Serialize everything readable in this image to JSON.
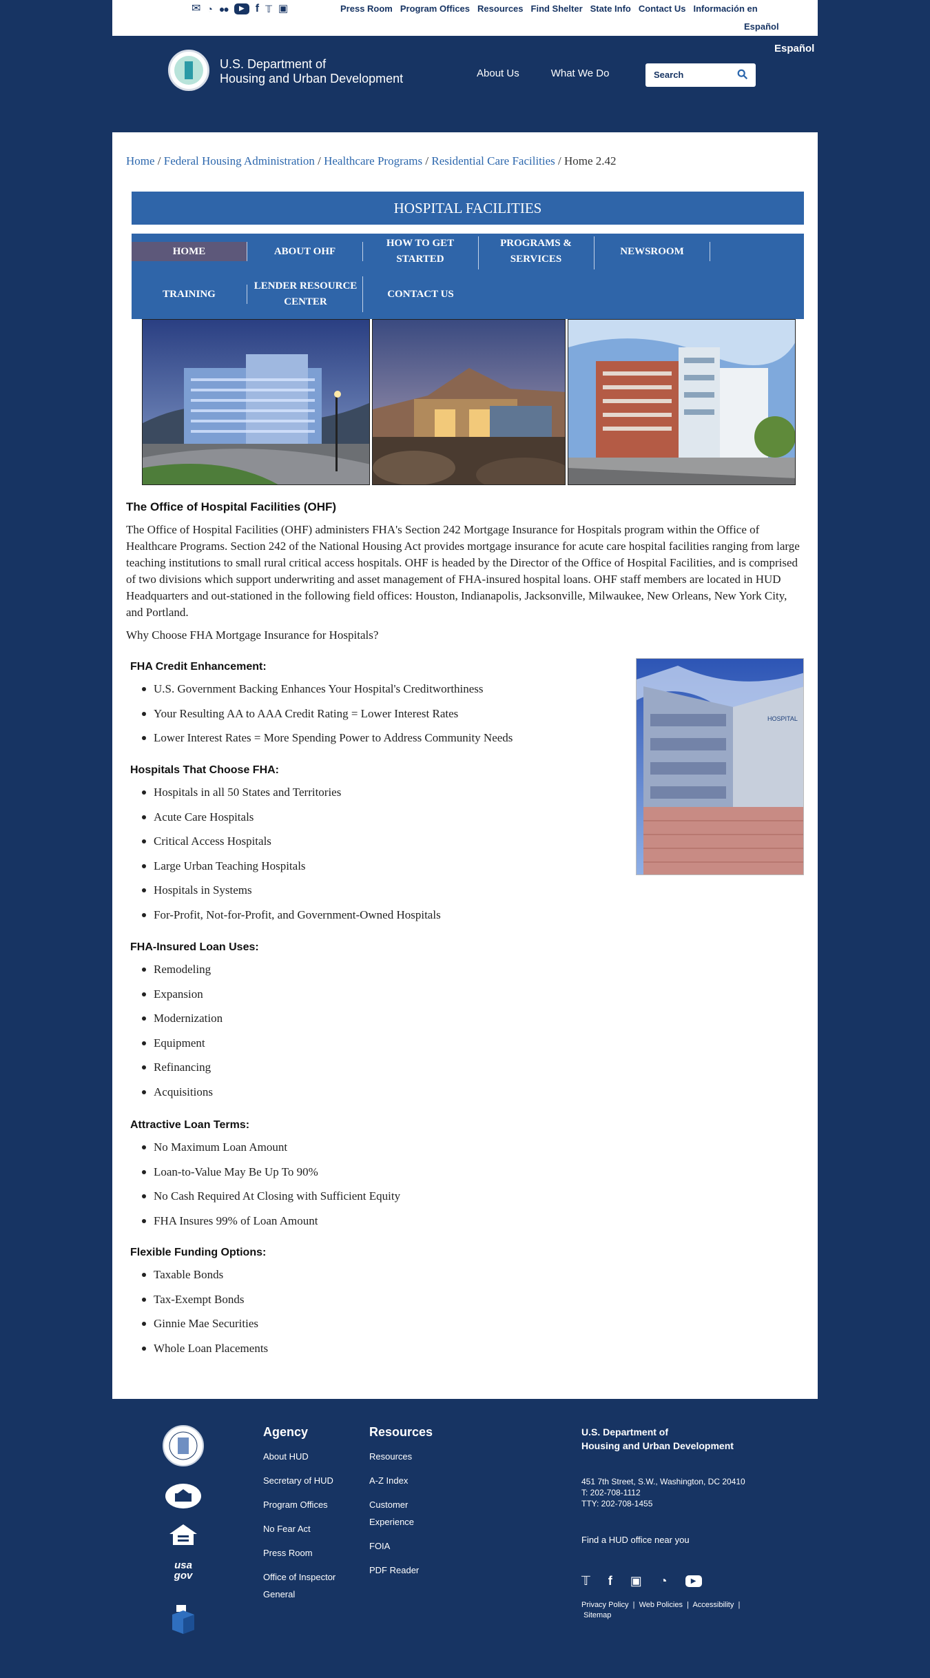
{
  "util": {
    "icons": [
      "mail-icon",
      "rss-icon",
      "flickr-icon",
      "youtube-icon",
      "facebook-icon",
      "twitter-icon",
      "instagram-icon"
    ],
    "links": [
      "Press Room",
      "Program Offices",
      "Resources",
      "Find Shelter",
      "State Info",
      "Contact Us",
      "Información en"
    ],
    "links_wrap": "Español"
  },
  "header": {
    "espanol": "Español",
    "agency_line1": "U.S. Department of",
    "agency_line2": "Housing and Urban Development",
    "nav": [
      "About Us",
      "What We Do"
    ],
    "search_placeholder": "Search"
  },
  "breadcrumb": {
    "items": [
      "Home",
      "Federal Housing Administration",
      "Healthcare Programs",
      "Residential Care Facilities"
    ],
    "current": "Home 2.42"
  },
  "hf": {
    "title": "HOSPITAL FACILITIES",
    "nav": [
      "HOME",
      "ABOUT OHF",
      "HOW TO GET STARTED",
      "PROGRAMS & SERVICES",
      "NEWSROOM",
      "TRAINING",
      "LENDER RESOURCE CENTER",
      "CONTACT US"
    ]
  },
  "ohf": {
    "heading": "The Office of Hospital Facilities (OHF)",
    "intro": "The Office of Hospital Facilities (OHF) administers FHA's Section 242 Mortgage Insurance for Hospitals program within the Office of Healthcare Programs. Section 242 of the National Housing Act provides mortgage insurance for acute care hospital facilities ranging from large teaching institutions to small rural critical access hospitals. OHF is headed by the Director of the Office of Hospital Facilities, and is comprised of two divisions which support underwriting and asset management of FHA-insured hospital loans. OHF staff members are located in HUD Headquarters and out-stationed in the following field offices: Houston, Indianapolis, Jacksonville, Milwaukee, New Orleans, New York City, and Portland.",
    "why": "Why Choose FHA Mortgage Insurance for Hospitals?"
  },
  "sections": [
    {
      "heading": "FHA Credit Enhancement:",
      "items": [
        "U.S. Government Backing Enhances Your Hospital's Creditworthiness",
        "Your Resulting AA to AAA Credit Rating = Lower Interest Rates",
        "Lower Interest Rates = More Spending Power to Address Community Needs"
      ]
    },
    {
      "heading": "Hospitals That Choose FHA:",
      "items": [
        "Hospitals in all 50 States and Territories",
        "Acute Care Hospitals",
        "Critical Access Hospitals",
        "Large Urban Teaching Hospitals",
        "Hospitals in Systems",
        "For-Profit, Not-for-Profit, and Government-Owned Hospitals"
      ]
    },
    {
      "heading": "FHA-Insured Loan Uses:",
      "items": [
        "Remodeling",
        "Expansion",
        "Modernization",
        "Equipment",
        "Refinancing",
        "Acquisitions"
      ]
    },
    {
      "heading": "Attractive Loan Terms:",
      "items": [
        "No Maximum Loan Amount",
        "Loan-to-Value May Be Up To 90%",
        "No Cash Required At Closing with Sufficient Equity",
        "FHA Insures 99% of Loan Amount"
      ]
    },
    {
      "heading": "Flexible Funding Options:",
      "items": [
        "Taxable Bonds",
        "Tax-Exempt Bonds",
        "Ginnie Mae Securities",
        "Whole Loan Placements"
      ]
    }
  ],
  "footer": {
    "agency_heading": "Agency",
    "agency_links": [
      "About HUD",
      "Secretary of HUD",
      "Program Offices",
      "No Fear Act",
      "Press Room",
      "Office of Inspector",
      "General"
    ],
    "resources_heading": "Resources",
    "resources_links": [
      "Resources",
      "A-Z Index",
      "Customer",
      "Experience",
      "FOIA",
      "PDF Reader"
    ],
    "org_line1": "U.S. Department of",
    "org_line2": "Housing and Urban Development",
    "address": "451 7th Street, S.W., Washington, DC 20410",
    "phone": "T: 202-708-1112",
    "tty": "TTY: 202-708-1455",
    "find_office": "Find a HUD office near you",
    "policy_links": [
      "Privacy Policy",
      "Web Policies",
      "Accessibility",
      "Sitemap"
    ],
    "usagov": "usa gov"
  }
}
